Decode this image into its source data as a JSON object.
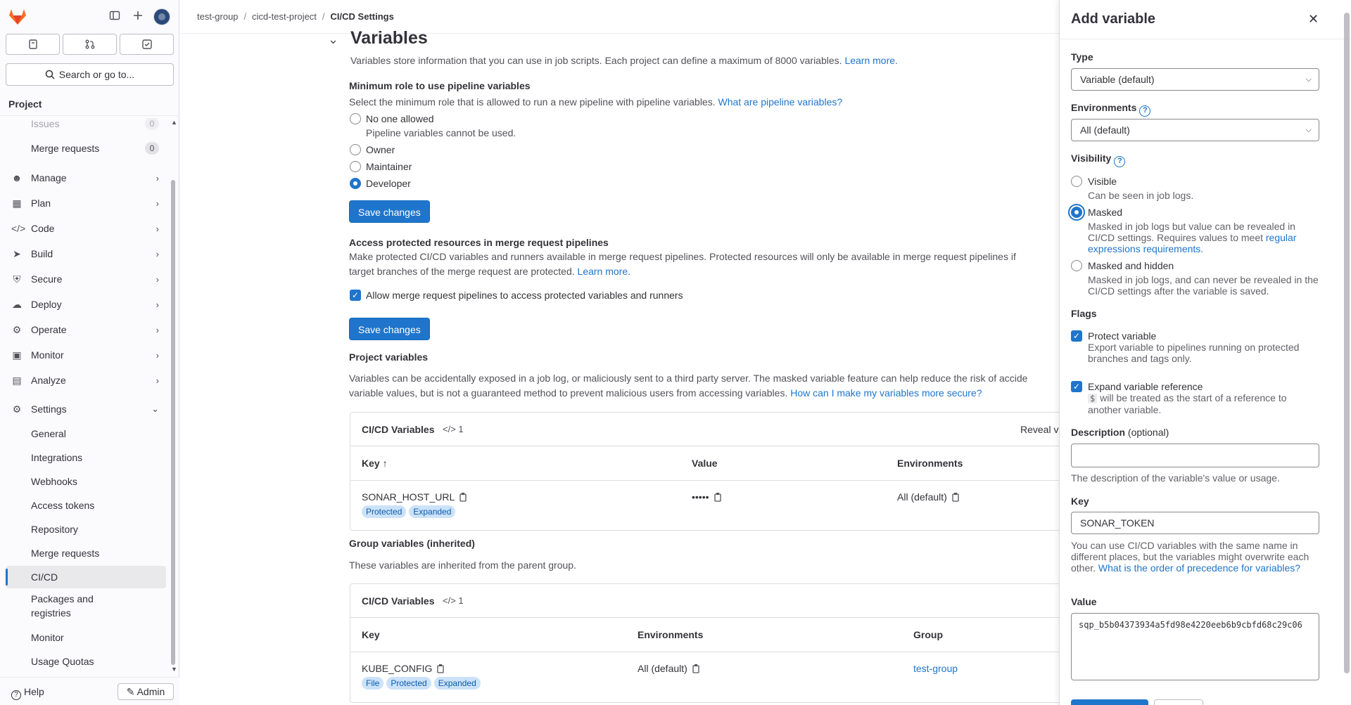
{
  "sidebar": {
    "project_label": "Project",
    "search_label": "Search or go to...",
    "items": [
      {
        "label": "Issues",
        "count": "0"
      },
      {
        "label": "Merge requests",
        "count": "0"
      },
      {
        "label": "Manage"
      },
      {
        "label": "Plan"
      },
      {
        "label": "Code"
      },
      {
        "label": "Build"
      },
      {
        "label": "Secure"
      },
      {
        "label": "Deploy"
      },
      {
        "label": "Operate"
      },
      {
        "label": "Monitor"
      },
      {
        "label": "Analyze"
      },
      {
        "label": "Settings"
      }
    ],
    "settings_sub": [
      "General",
      "Integrations",
      "Webhooks",
      "Access tokens",
      "Repository",
      "Merge requests",
      "CI/CD",
      "Packages and registries",
      "Monitor",
      "Usage Quotas"
    ],
    "help": "Help",
    "admin": "Admin"
  },
  "breadcrumb": {
    "a": "test-group",
    "b": "cicd-test-project",
    "c": "CI/CD Settings"
  },
  "main": {
    "title": "Variables",
    "desc": "Variables store information that you can use in job scripts. Each project can define a maximum of 8000 variables.",
    "learn_more": "Learn more.",
    "min_role_title": "Minimum role to use pipeline variables",
    "min_role_desc": "Select the minimum role that is allowed to run a new pipeline with pipeline variables.",
    "min_role_link": "What are pipeline variables?",
    "roles": [
      "No one allowed",
      "Owner",
      "Maintainer",
      "Developer"
    ],
    "role_help": "Pipeline variables cannot be used.",
    "save": "Save changes",
    "access_title": "Access protected resources in merge request pipelines",
    "access_desc1": "Make protected CI/CD variables and runners available in merge request pipelines. Protected resources will only be available in merge request pipelines if",
    "access_desc2": "target branches of the merge request are protected.",
    "access_checkbox": "Allow merge request pipelines to access protected variables and runners",
    "project_vars_title": "Project variables",
    "project_vars_desc1": "Variables can be accidentally exposed in a job log, or maliciously sent to a third party server. The masked variable feature can help reduce the risk of accide",
    "project_vars_desc2": "variable values, but is not a guaranteed method to prevent malicious users from accessing variables.",
    "project_vars_link": "How can I make my variables more secure?",
    "card1": {
      "title": "CI/CD Variables",
      "count": "1",
      "reveal": "Reveal v",
      "headers": [
        "Key",
        "Value",
        "Environments"
      ],
      "row": {
        "key": "SONAR_HOST_URL",
        "value": "•••••",
        "env": "All (default)",
        "badges": [
          "Protected",
          "Expanded"
        ]
      }
    },
    "group_title": "Group variables (inherited)",
    "group_desc": "These variables are inherited from the parent group.",
    "card2": {
      "title": "CI/CD Variables",
      "count": "1",
      "headers": [
        "Key",
        "Environments",
        "Group"
      ],
      "row": {
        "key": "KUBE_CONFIG",
        "env": "All (default)",
        "group": "test-group",
        "badges": [
          "File",
          "Protected",
          "Expanded"
        ]
      }
    }
  },
  "drawer": {
    "title": "Add variable",
    "type_label": "Type",
    "type_value": "Variable (default)",
    "env_label": "Environments",
    "env_value": "All (default)",
    "visibility_label": "Visibility",
    "vis_visible": "Visible",
    "vis_visible_help": "Can be seen in job logs.",
    "vis_masked": "Masked",
    "vis_masked_help": "Masked in job logs but value can be revealed in CI/CD settings. Requires values to meet",
    "vis_masked_link": "regular expressions requirements.",
    "vis_hidden": "Masked and hidden",
    "vis_hidden_help": "Masked in job logs, and can never be revealed in the CI/CD settings after the variable is saved.",
    "flags_label": "Flags",
    "flag_protect": "Protect variable",
    "flag_protect_help": "Export variable to pipelines running on protected branches and tags only.",
    "flag_expand": "Expand variable reference",
    "flag_expand_code": "$",
    "flag_expand_help": "will be treated as the start of a reference to another variable.",
    "desc_label": "Description",
    "desc_optional": "(optional)",
    "desc_help": "The description of the variable's value or usage.",
    "key_label": "Key",
    "key_value": "SONAR_TOKEN",
    "key_help": "You can use CI/CD variables with the same name in different places, but the variables might overwrite each other.",
    "key_link": "What is the order of precedence for variables?",
    "value_label": "Value",
    "value_value": "sqp_b5b04373934a5fd98e4220eeb6b9cbfd68c29c06"
  },
  "colors": {
    "accent": "#1f75cb",
    "badge_bg": "#cbe2f9",
    "sidebar_bg": "#fbfafd"
  }
}
